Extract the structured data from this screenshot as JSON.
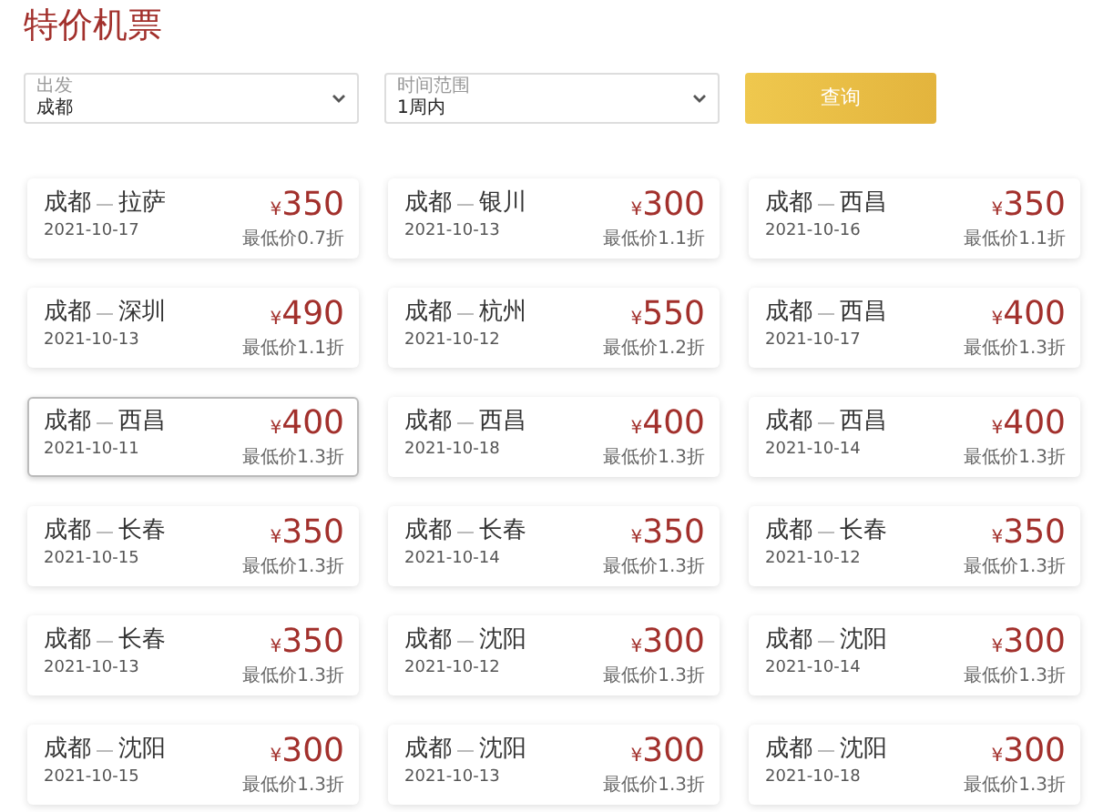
{
  "title": "特价机票",
  "filters": [
    {
      "label": "出发",
      "value": "成都"
    },
    {
      "label": "时间范围",
      "value": "1周内"
    }
  ],
  "search_button": "查询",
  "flights": [
    {
      "from": "成都",
      "to": "拉萨",
      "date": "2021-10-17",
      "currency": "¥",
      "price": "350",
      "discount": "最低价0.7折",
      "selected": false
    },
    {
      "from": "成都",
      "to": "银川",
      "date": "2021-10-13",
      "currency": "¥",
      "price": "300",
      "discount": "最低价1.1折",
      "selected": false
    },
    {
      "from": "成都",
      "to": "西昌",
      "date": "2021-10-16",
      "currency": "¥",
      "price": "350",
      "discount": "最低价1.1折",
      "selected": false
    },
    {
      "from": "成都",
      "to": "深圳",
      "date": "2021-10-13",
      "currency": "¥",
      "price": "490",
      "discount": "最低价1.1折",
      "selected": false
    },
    {
      "from": "成都",
      "to": "杭州",
      "date": "2021-10-12",
      "currency": "¥",
      "price": "550",
      "discount": "最低价1.2折",
      "selected": false
    },
    {
      "from": "成都",
      "to": "西昌",
      "date": "2021-10-17",
      "currency": "¥",
      "price": "400",
      "discount": "最低价1.3折",
      "selected": false
    },
    {
      "from": "成都",
      "to": "西昌",
      "date": "2021-10-11",
      "currency": "¥",
      "price": "400",
      "discount": "最低价1.3折",
      "selected": true
    },
    {
      "from": "成都",
      "to": "西昌",
      "date": "2021-10-18",
      "currency": "¥",
      "price": "400",
      "discount": "最低价1.3折",
      "selected": false
    },
    {
      "from": "成都",
      "to": "西昌",
      "date": "2021-10-14",
      "currency": "¥",
      "price": "400",
      "discount": "最低价1.3折",
      "selected": false
    },
    {
      "from": "成都",
      "to": "长春",
      "date": "2021-10-15",
      "currency": "¥",
      "price": "350",
      "discount": "最低价1.3折",
      "selected": false
    },
    {
      "from": "成都",
      "to": "长春",
      "date": "2021-10-14",
      "currency": "¥",
      "price": "350",
      "discount": "最低价1.3折",
      "selected": false
    },
    {
      "from": "成都",
      "to": "长春",
      "date": "2021-10-12",
      "currency": "¥",
      "price": "350",
      "discount": "最低价1.3折",
      "selected": false
    },
    {
      "from": "成都",
      "to": "长春",
      "date": "2021-10-13",
      "currency": "¥",
      "price": "350",
      "discount": "最低价1.3折",
      "selected": false
    },
    {
      "from": "成都",
      "to": "沈阳",
      "date": "2021-10-12",
      "currency": "¥",
      "price": "300",
      "discount": "最低价1.3折",
      "selected": false
    },
    {
      "from": "成都",
      "to": "沈阳",
      "date": "2021-10-14",
      "currency": "¥",
      "price": "300",
      "discount": "最低价1.3折",
      "selected": false
    },
    {
      "from": "成都",
      "to": "沈阳",
      "date": "2021-10-15",
      "currency": "¥",
      "price": "300",
      "discount": "最低价1.3折",
      "selected": false
    },
    {
      "from": "成都",
      "to": "沈阳",
      "date": "2021-10-13",
      "currency": "¥",
      "price": "300",
      "discount": "最低价1.3折",
      "selected": false
    },
    {
      "from": "成都",
      "to": "沈阳",
      "date": "2021-10-18",
      "currency": "¥",
      "price": "300",
      "discount": "最低价1.3折",
      "selected": false
    }
  ]
}
